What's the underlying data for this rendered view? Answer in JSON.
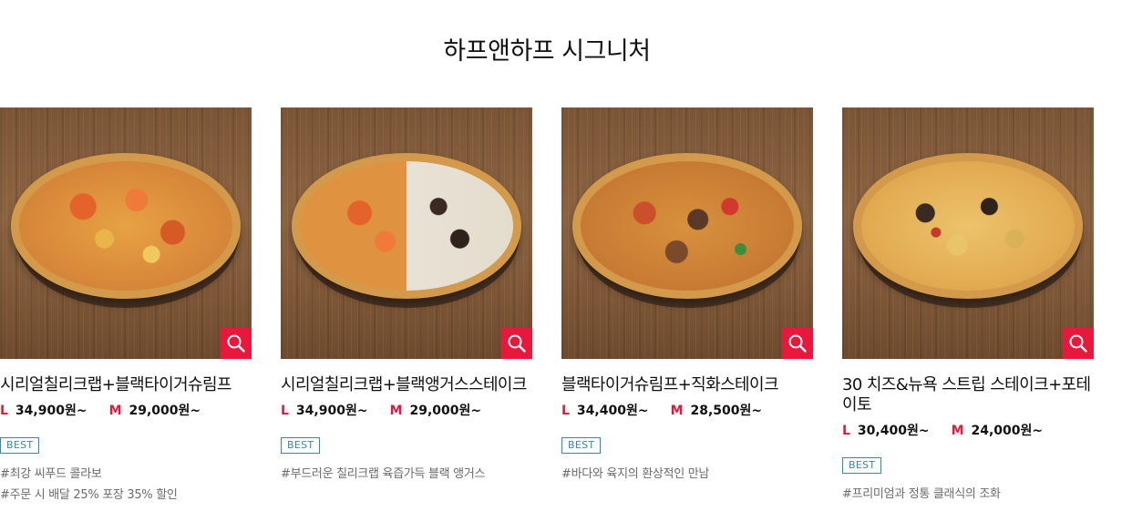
{
  "section": {
    "title": "하프앤하프 시그니처"
  },
  "colors": {
    "accent": "#e8173c",
    "badge": "#2e8bb5",
    "tag_text": "#6b6b6b"
  },
  "zoom_icon": "magnifier-icon",
  "products": [
    {
      "name": "시리얼칠리크랩+블랙타이거슈림프",
      "size_l": "L",
      "price_l": "34,900원~",
      "size_m": "M",
      "price_m": "29,000원~",
      "badge": "BEST",
      "tags": [
        "#최강 씨푸드 콜라보",
        "#주문 시 배달 25% 포장 35% 할인"
      ]
    },
    {
      "name": "시리얼칠리크랩+블랙앵거스스테이크",
      "size_l": "L",
      "price_l": "34,900원~",
      "size_m": "M",
      "price_m": "29,000원~",
      "badge": "BEST",
      "tags": [
        "#부드러운 칠리크랩 육즙가득 블랙 앵거스"
      ]
    },
    {
      "name": "블랙타이거슈림프+직화스테이크",
      "size_l": "L",
      "price_l": "34,400원~",
      "size_m": "M",
      "price_m": "28,500원~",
      "badge": "BEST",
      "tags": [
        "#바다와 육지의 환상적인 만남"
      ]
    },
    {
      "name": "30 치즈&뉴욕 스트립 스테이크+포테이토",
      "size_l": "L",
      "price_l": "30,400원~",
      "size_m": "M",
      "price_m": "24,000원~",
      "badge": "BEST",
      "tags": [
        "#프리미엄과 정통 클래식의 조화"
      ]
    }
  ]
}
